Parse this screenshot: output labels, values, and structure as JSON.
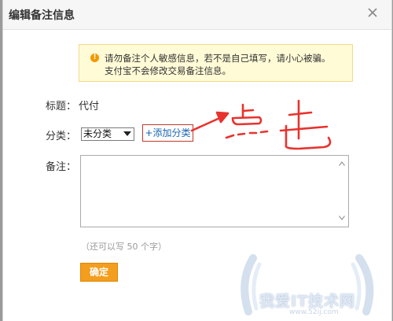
{
  "dialog": {
    "title": "编辑备注信息",
    "close_label": "×"
  },
  "notice": {
    "icon": "warning-icon",
    "icon_glyph": "!",
    "line1": "请勿备注个人敏感信息，若不是自己填写，请小心被骗。",
    "line2": "支付宝不会修改交易备注信息。"
  },
  "form": {
    "title_label": "标题：",
    "title_value": "代付",
    "category_label": "分类：",
    "category_selected": "未分类",
    "add_category": "+添加分类",
    "remark_label": "备注：",
    "remark_value": "",
    "counter": "（还可以写 50 个字）",
    "confirm": "确定"
  },
  "annotation": {
    "handwritten_text": "点击",
    "color": "#e8322d"
  },
  "watermark": {
    "text": "我爱IT技术网",
    "url": "www.52ij.com"
  },
  "colors": {
    "accent": "#f39e1e",
    "link": "#1a66b3",
    "notice_bg": "#fffbd6"
  }
}
